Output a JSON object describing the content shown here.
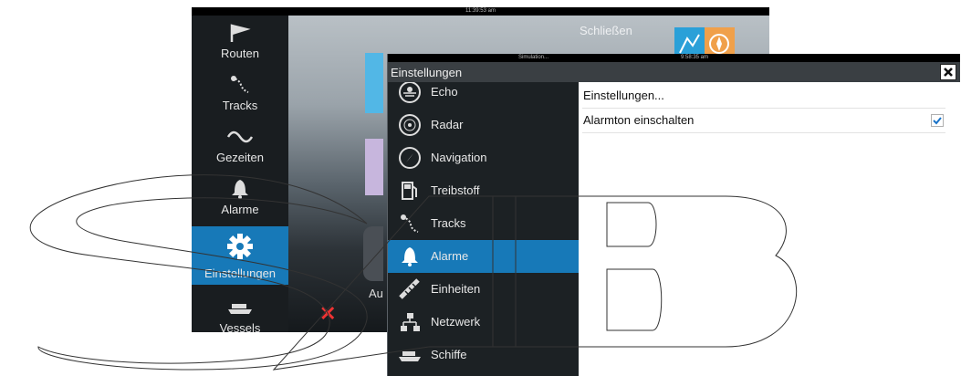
{
  "background_screen": {
    "clock": "11:39:53 am",
    "close_label": "Schließen",
    "sidebar": [
      {
        "label": "Routen",
        "icon": "route-flag-icon",
        "active": false
      },
      {
        "label": "Tracks",
        "icon": "tracks-icon",
        "active": false
      },
      {
        "label": "Gezeiten",
        "icon": "tide-wave-icon",
        "active": false
      },
      {
        "label": "Alarme",
        "icon": "bell-icon",
        "active": false
      },
      {
        "label": "Einstellungen",
        "icon": "gear-icon",
        "active": true
      },
      {
        "label": "Vessels",
        "icon": "vessel-icon",
        "active": false
      }
    ],
    "partial_label": "Au"
  },
  "dialog": {
    "status_left": "Simulation...",
    "status_time": "9:58:35 am",
    "title": "Einstellungen",
    "menu": [
      {
        "label": "Echo",
        "icon": "echo-sounder-icon",
        "active": false
      },
      {
        "label": "Radar",
        "icon": "radar-icon",
        "active": false
      },
      {
        "label": "Navigation",
        "icon": "compass-icon",
        "active": false
      },
      {
        "label": "Treibstoff",
        "icon": "fuel-pump-icon",
        "active": false
      },
      {
        "label": "Tracks",
        "icon": "tracks-icon",
        "active": false
      },
      {
        "label": "Alarme",
        "icon": "bell-icon",
        "active": true
      },
      {
        "label": "Einheiten",
        "icon": "ruler-icon",
        "active": false
      },
      {
        "label": "Netzwerk",
        "icon": "network-icon",
        "active": false
      },
      {
        "label": "Schiffe",
        "icon": "vessel-icon",
        "active": false
      }
    ],
    "settings": [
      {
        "label": "Einstellungen...",
        "checked": null
      },
      {
        "label": "Alarmton einschalten",
        "checked": true
      }
    ]
  },
  "watermark": "SAB",
  "colors": {
    "accent": "#1779b8",
    "sidebar_bg": "#1c2124",
    "titlebar_bg": "#3a3f43",
    "checkmark": "#1a73c8",
    "alert_x": "#e33333"
  }
}
